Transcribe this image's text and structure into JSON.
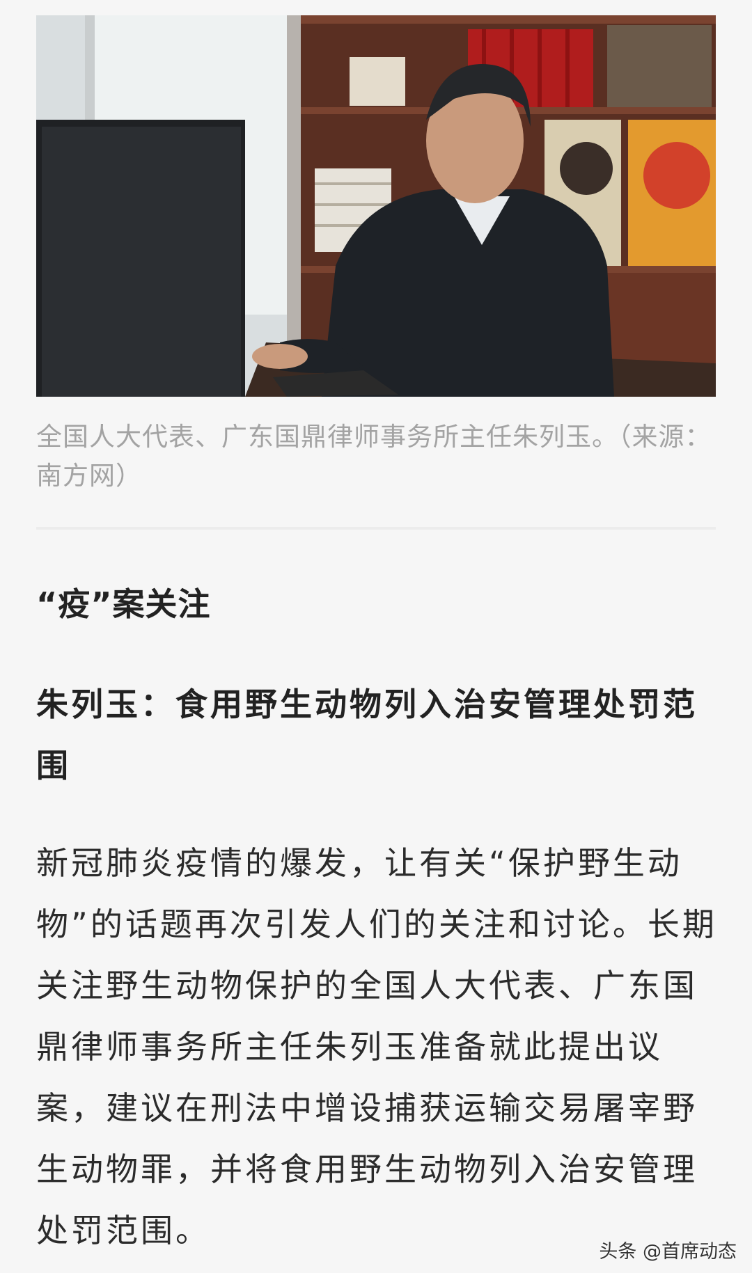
{
  "photo": {
    "alt_subject": "man-at-computer-photo"
  },
  "caption": "全国人大代表、广东国鼎律师事务所主任朱列玉。（来源：南方网）",
  "section_title": "“疫”案关注",
  "sub_title": "朱列玉：食用野生动物列入治安管理处罚范围",
  "paragraph": "新冠肺炎疫情的爆发，让有关“保护野生动物”的话题再次引发人们的关注和讨论。长期关注野生动物保护的全国人大代表、广东国鼎律师事务所主任朱列玉准备就此提出议案，建议在刑法中增设捕获运输交易屠宰野生动物罪，并将食用野生动物列入治安管理处罚范围。",
  "watermark": "头条 @首席动态"
}
